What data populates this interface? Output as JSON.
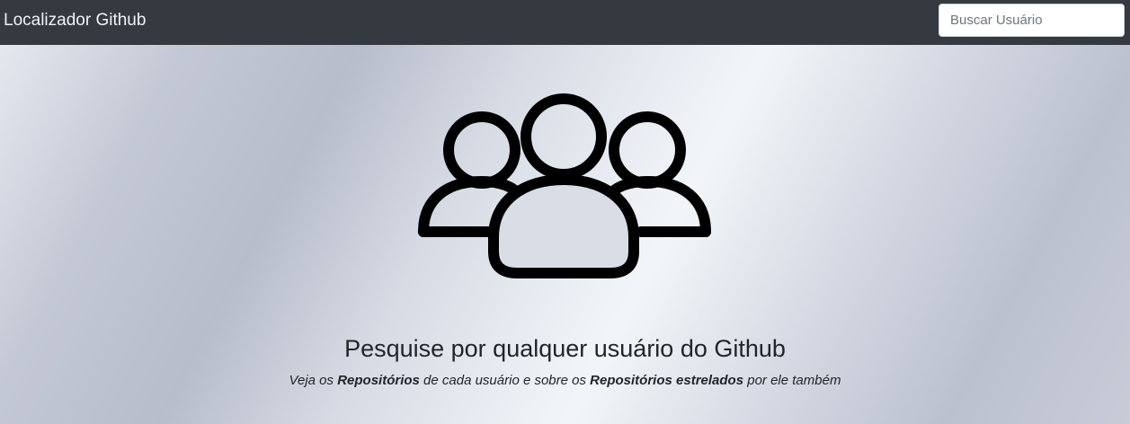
{
  "navbar": {
    "brand": "Localizador Github",
    "search_placeholder": "Buscar Usuário",
    "search_value": "",
    "background": "#343a40"
  },
  "hero": {
    "icon": "users-group-icon",
    "title": "Pesquise por qualquer usuário do Github",
    "subtitle": {
      "part1": "Veja os ",
      "bold1": "Repositórios",
      "part2": " de cada usuário e sobre os ",
      "bold2": "Repositórios estrelados",
      "part3": " por ele também"
    }
  }
}
